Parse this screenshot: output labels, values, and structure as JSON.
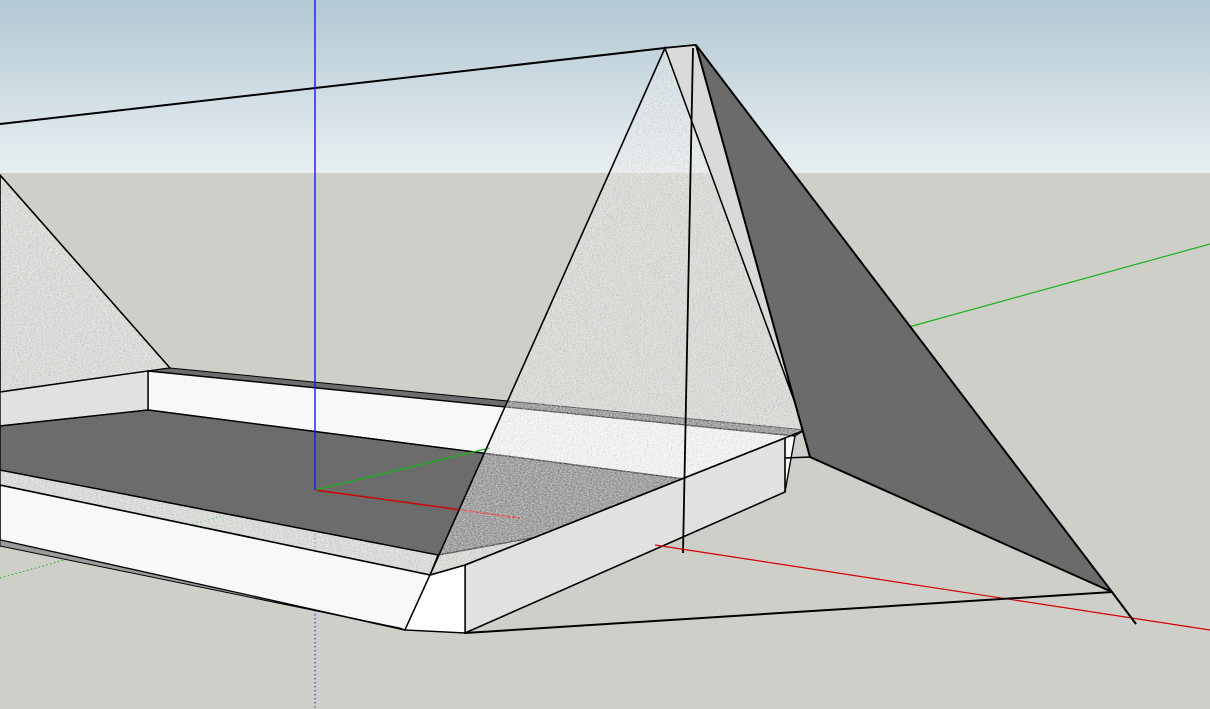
{
  "app": {
    "window": "3d-modeling-viewport"
  },
  "scene": {
    "sky_top_color": "#b2c8d4",
    "sky_bottom_color": "#e9eff1",
    "ground_color": "#cfcfca",
    "axis_red_color": "#d40000",
    "axis_green_color": "#18b418",
    "axis_blue_color": "#1a1ae0",
    "dark_face_color": "#6b6b6b",
    "mid_face_color": "#7a7a7a",
    "light_face_color": "#e1e1e1",
    "white_face_color": "#f8f8f8",
    "texture_face_color": "#b9b9b9",
    "edge_color": "#000000"
  }
}
